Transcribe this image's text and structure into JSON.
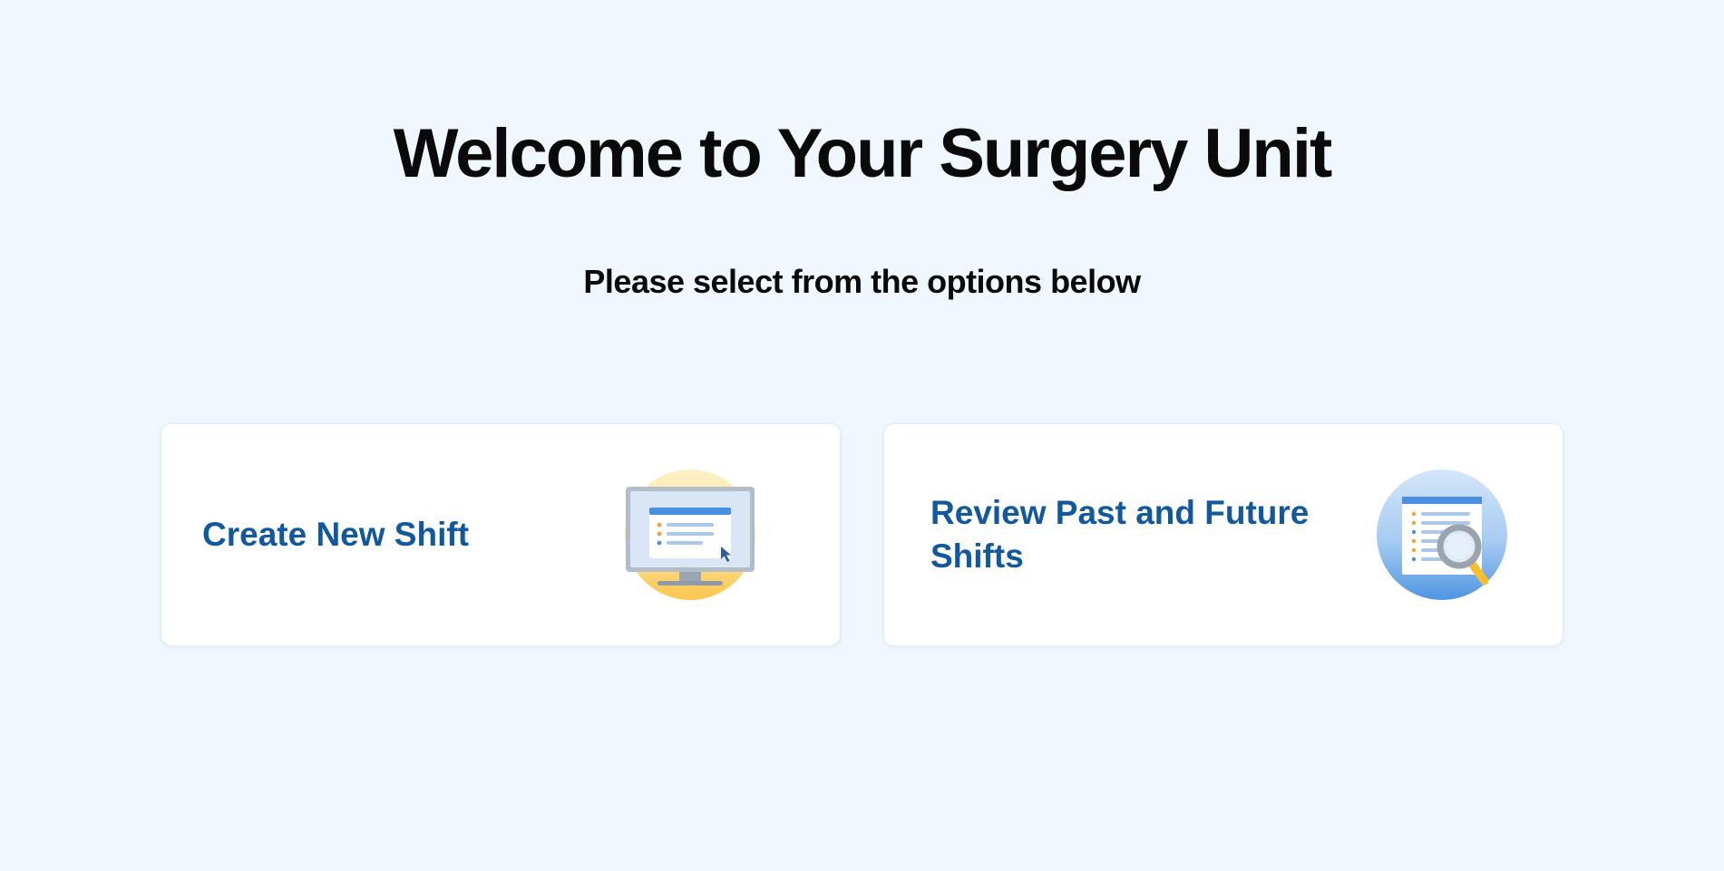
{
  "header": {
    "title": "Welcome to Your Surgery Unit",
    "subtitle": "Please select from the options below"
  },
  "cards": [
    {
      "label": "Create New Shift",
      "icon": "computer-monitor-icon"
    },
    {
      "label": "Review Past and Future Shifts",
      "icon": "document-search-icon"
    }
  ],
  "colors": {
    "background": "#f0f7fe",
    "card_text": "#12589e",
    "heading_text": "#0a0a0a"
  }
}
